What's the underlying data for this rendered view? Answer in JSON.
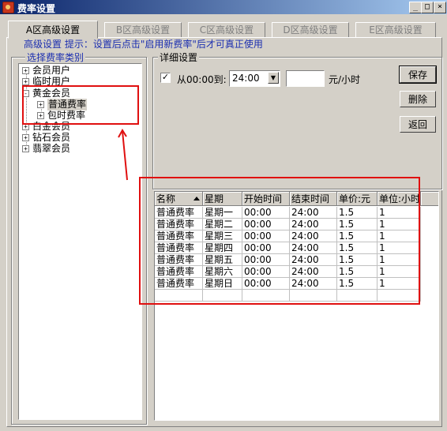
{
  "window": {
    "title": "费率设置",
    "min_label": "_",
    "max_label": "□",
    "close_label": "×"
  },
  "tabs": [
    {
      "label": "A区高级设置",
      "active": true
    },
    {
      "label": "B区高级设置",
      "active": false
    },
    {
      "label": "C区高级设置",
      "active": false
    },
    {
      "label": "D区高级设置",
      "active": false
    },
    {
      "label": "E区高级设置",
      "active": false
    }
  ],
  "hint": "高级设置  提示：设置后点击\"启用新费率\"后才可真正使用",
  "category_group": {
    "label": "选择费率类别"
  },
  "tree": {
    "nodes": [
      {
        "label": "会员用户",
        "expander": "+"
      },
      {
        "label": "临时用户",
        "expander": "+"
      },
      {
        "label": "黄金会员",
        "expander": "-"
      },
      {
        "label": "普通费率",
        "expander": "+"
      },
      {
        "label": "包时费率",
        "expander": "+"
      },
      {
        "label": "白金会员",
        "expander": "+"
      },
      {
        "label": "钻石会员",
        "expander": "+"
      },
      {
        "label": "翡翠会员",
        "expander": "+"
      }
    ]
  },
  "detail": {
    "label": "详细设置",
    "enabled_check": "✓",
    "from_label": "从00:00到:",
    "to_time": "24:00",
    "price_value": "",
    "unit_label": "元/小时",
    "select_arrow": "▼"
  },
  "buttons": {
    "save": "保存",
    "delete": "删除",
    "back": "返回"
  },
  "accent_red": "#e01010",
  "table": {
    "columns": [
      "名称",
      "星期",
      "开始时间",
      "结束时间",
      "单价:元",
      "单位:小时"
    ],
    "rows": [
      [
        "普通费率",
        "星期一",
        "00:00",
        "24:00",
        "1.5",
        "1"
      ],
      [
        "普通费率",
        "星期二",
        "00:00",
        "24:00",
        "1.5",
        "1"
      ],
      [
        "普通费率",
        "星期三",
        "00:00",
        "24:00",
        "1.5",
        "1"
      ],
      [
        "普通费率",
        "星期四",
        "00:00",
        "24:00",
        "1.5",
        "1"
      ],
      [
        "普通费率",
        "星期五",
        "00:00",
        "24:00",
        "1.5",
        "1"
      ],
      [
        "普通费率",
        "星期六",
        "00:00",
        "24:00",
        "1.5",
        "1"
      ],
      [
        "普通费率",
        "星期日",
        "00:00",
        "24:00",
        "1.5",
        "1"
      ]
    ]
  }
}
